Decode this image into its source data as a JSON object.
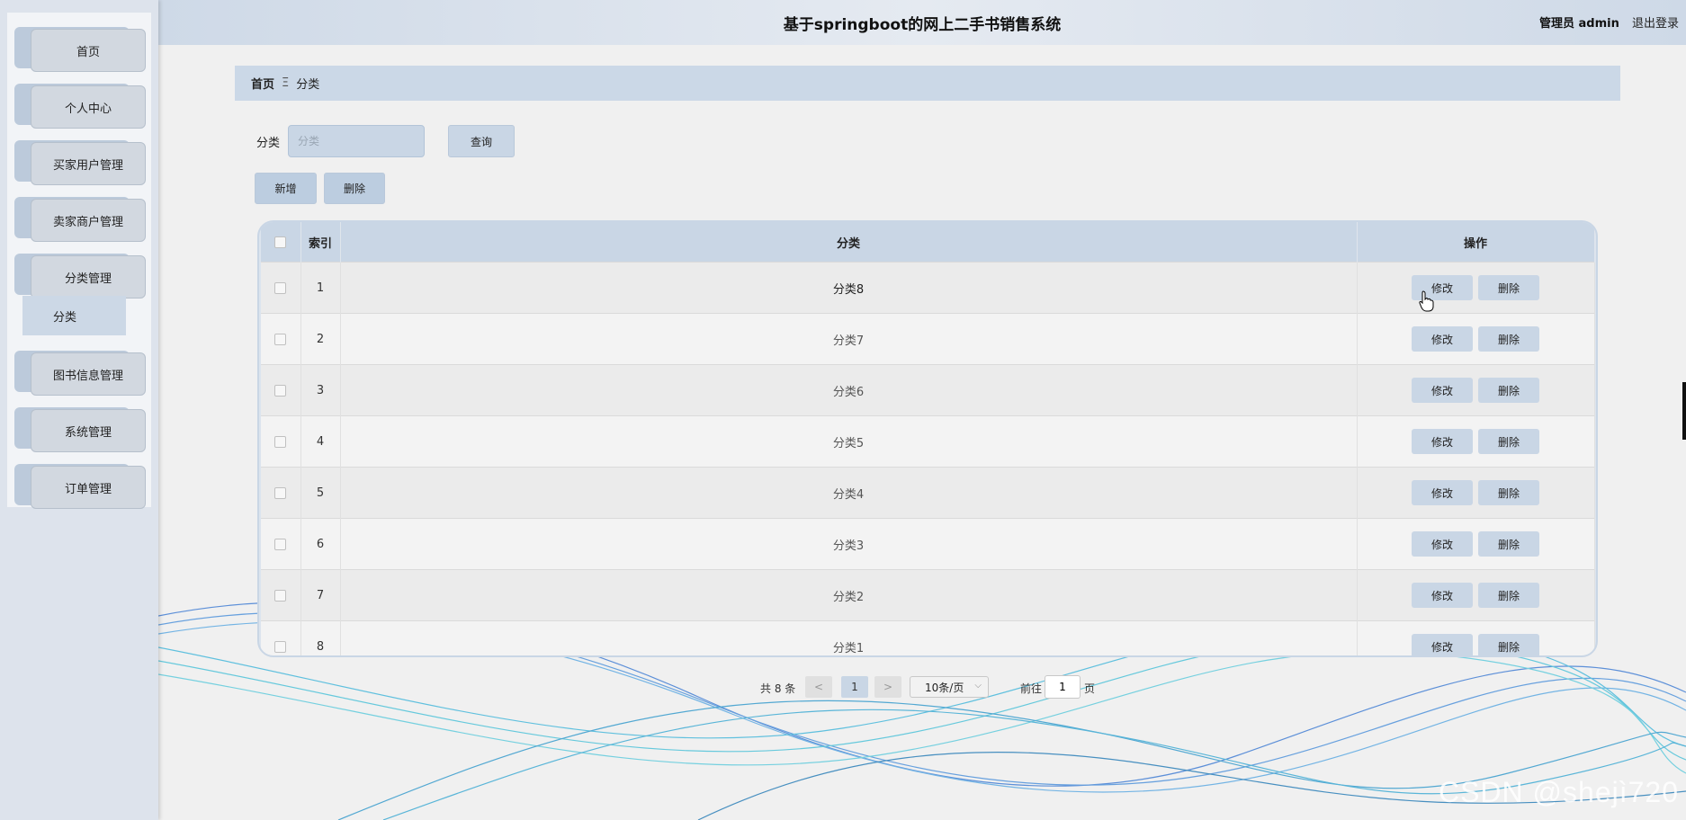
{
  "header": {
    "title": "基于springboot的网上二手书销售系统",
    "user_role": "管理员 admin",
    "logout_label": "退出登录"
  },
  "sidebar": {
    "items": [
      {
        "label": "首页"
      },
      {
        "label": "个人中心"
      },
      {
        "label": "买家用户管理"
      },
      {
        "label": "卖家商户管理"
      },
      {
        "label": "分类管理"
      },
      {
        "label": "图书信息管理"
      },
      {
        "label": "系统管理"
      },
      {
        "label": "订单管理"
      }
    ],
    "active_sub": "分类"
  },
  "breadcrumb": {
    "home": "首页",
    "separator": "Ξ",
    "current": "分类"
  },
  "search": {
    "label": "分类",
    "placeholder": "分类",
    "query_button": "查询"
  },
  "actions": {
    "add": "新增",
    "delete": "删除"
  },
  "table": {
    "columns": [
      "索引",
      "分类",
      "操作"
    ],
    "rows": [
      {
        "index": "1",
        "name": "分类8"
      },
      {
        "index": "2",
        "name": "分类7"
      },
      {
        "index": "3",
        "name": "分类6"
      },
      {
        "index": "4",
        "name": "分类5"
      },
      {
        "index": "5",
        "name": "分类4"
      },
      {
        "index": "6",
        "name": "分类3"
      },
      {
        "index": "7",
        "name": "分类2"
      },
      {
        "index": "8",
        "name": "分类1"
      }
    ],
    "edit_label": "修改",
    "delete_label": "删除"
  },
  "pagination": {
    "total": "共 8 条",
    "prev": "<",
    "current_page": "1",
    "next": ">",
    "page_size": "10条/页",
    "goto_label": "前往",
    "goto_value": "1",
    "page_suffix": "页"
  },
  "watermark": "CSDN @shejì720",
  "colors": {
    "accent": "#c9d6e5",
    "sidebar_bg": "#dde3ec"
  }
}
